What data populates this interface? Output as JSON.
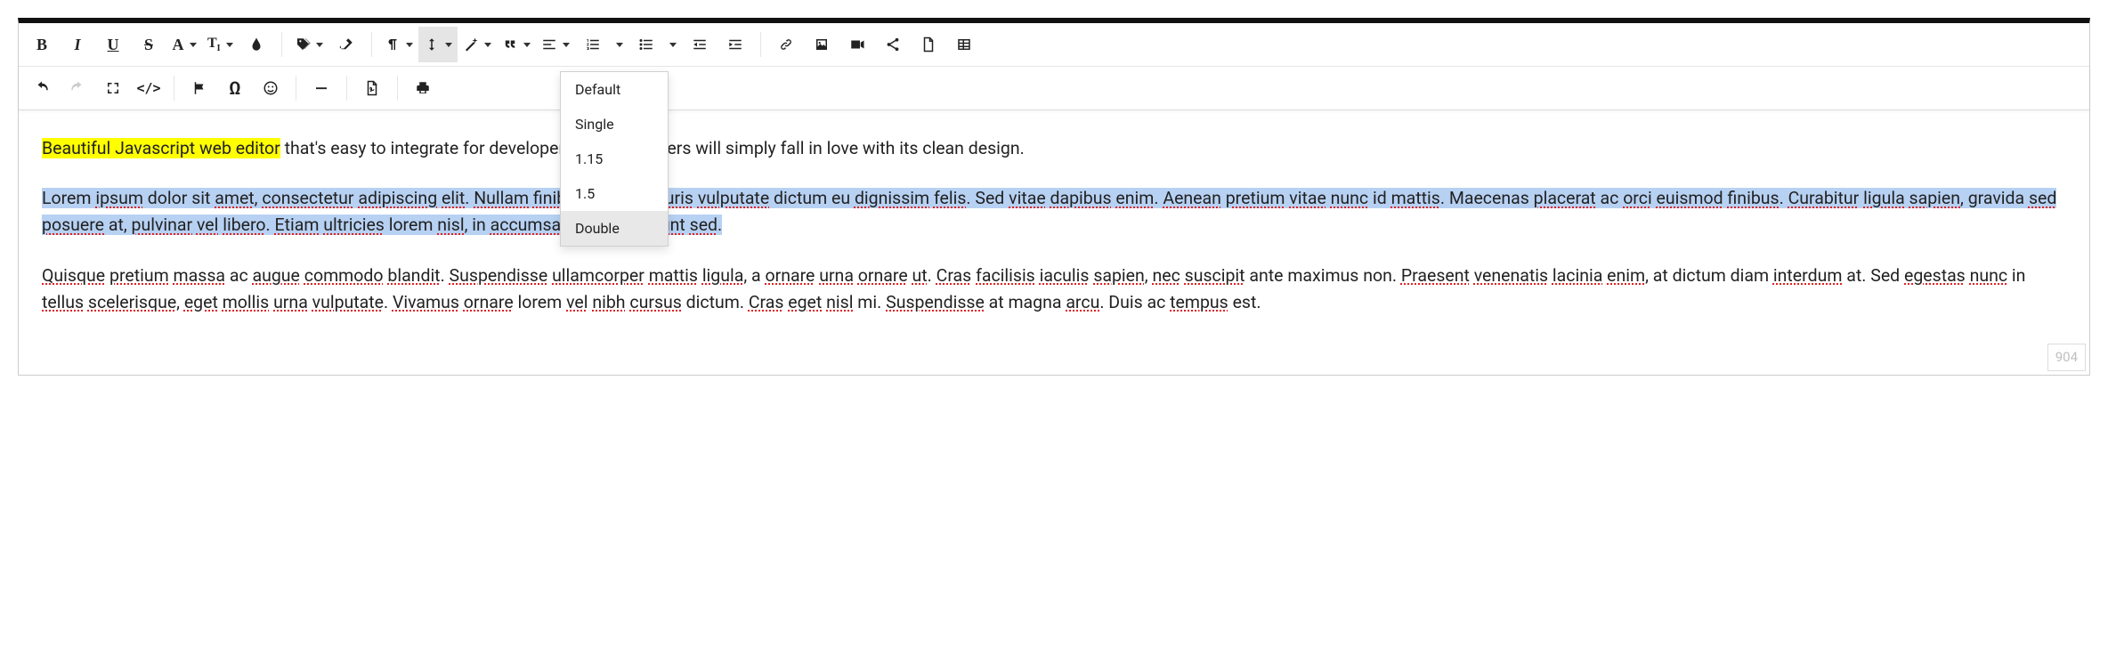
{
  "dropdown": {
    "items": [
      "Default",
      "Single",
      "1.15",
      "1.5",
      "Double"
    ],
    "hovered_index": 4
  },
  "content": {
    "intro_hl": "Beautiful Javascript web editor",
    "intro_rest": " that's easy to integrate for developers and your users will simply fall in love with its clean design.",
    "p2_full": "Lorem ipsum dolor sit amet, consectetur adipiscing elit. Nullam finibus est ac mauris vulputate dictum eu dignissim felis. Sed vitae dapibus enim. Aenean pretium vitae nunc id mattis. Maecenas placerat ac orci euismod finibus. Curabitur ligula sapien, gravida sed posuere at, pulvinar vel libero. Etiam ultricies lorem nisl, in accumsan diam tincidunt sed.",
    "p3_full": "Quisque pretium massa ac augue commodo blandit. Suspendisse ullamcorper mattis ligula, a ornare urna ornare ut. Cras facilisis iaculis sapien, nec suscipit ante maximus non. Praesent venenatis lacinia enim, at dictum diam interdum at. Sed egestas nunc in tellus scelerisque, eget mollis urna vulputate. Vivamus ornare lorem vel nibh cursus dictum. Cras eget nisl mi. Suspendisse at magna arcu. Duis ac tempus est."
  },
  "counter": "904"
}
